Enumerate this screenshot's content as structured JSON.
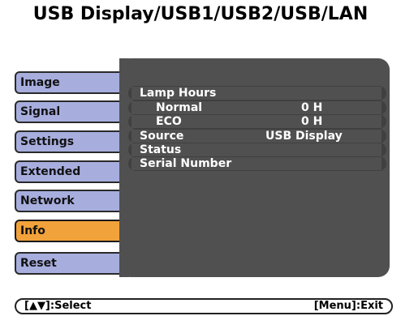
{
  "window": {
    "title": "USB Display/USB1/USB2/USB/LAN"
  },
  "menu": {
    "tabs": [
      {
        "label": "Image",
        "active": false
      },
      {
        "label": "Signal",
        "active": false
      },
      {
        "label": "Settings",
        "active": false
      },
      {
        "label": "Extended",
        "active": false
      },
      {
        "label": "Network",
        "active": false
      },
      {
        "label": "Info",
        "active": true
      },
      {
        "label": "Reset",
        "active": false
      }
    ],
    "active_color": "#f2a23b",
    "inactive_color": "#a7aede"
  },
  "info": {
    "lamp_hours_label": "Lamp Hours",
    "normal_label": "Normal",
    "normal_value": "0 H",
    "eco_label": "ECO",
    "eco_value": "0 H",
    "source_label": "Source",
    "source_value": "USB Display",
    "status_label": "Status",
    "serial_label": "Serial Number"
  },
  "footer": {
    "select_hint": "[▲▼]:Select",
    "exit_hint": "[Menu]:Exit"
  }
}
